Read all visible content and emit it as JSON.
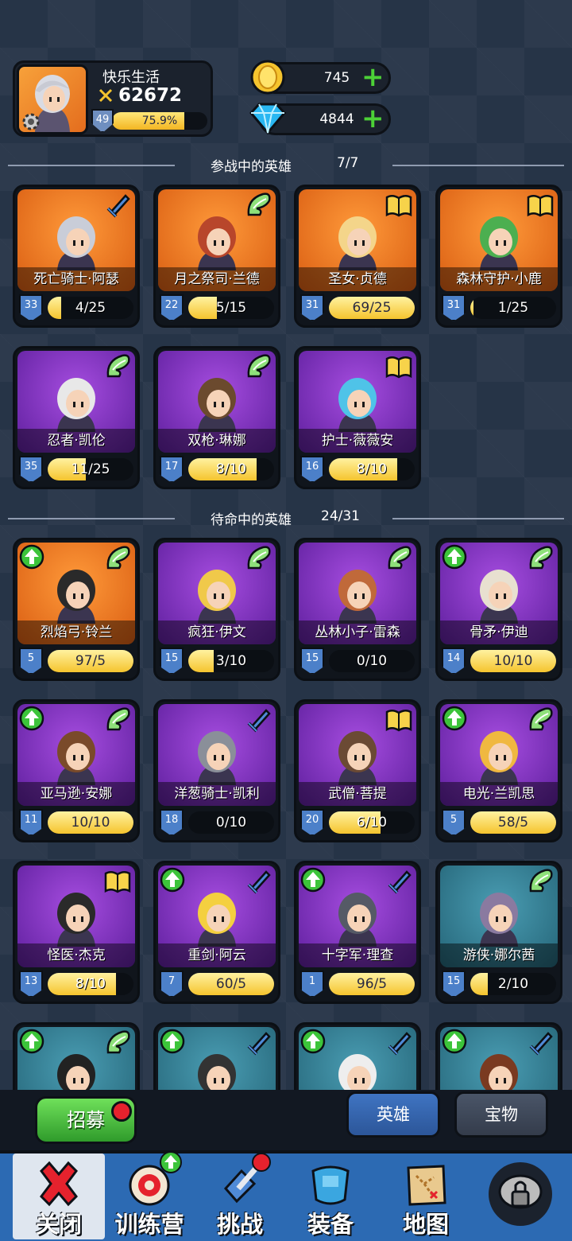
{
  "profile": {
    "name": "快乐生活",
    "power": "62672",
    "level": "49",
    "xp_percent": "75.9%",
    "xp_fraction": 0.759
  },
  "currency": {
    "gold": "745",
    "gems": "4844"
  },
  "active": {
    "title": "参战中的英雄",
    "count": "7/7"
  },
  "reserve": {
    "title": "待命中的英雄",
    "count": "24/31"
  },
  "cards": [
    {
      "name": "死亡骑士·阿瑟",
      "level": "33",
      "progress": "4/25",
      "fill": 0.16,
      "bg": "orange",
      "badge": "sword-icon",
      "up": false
    },
    {
      "name": "月之祭司·兰德",
      "level": "22",
      "progress": "5/15",
      "fill": 0.33,
      "bg": "orange",
      "badge": "wing-icon",
      "up": false
    },
    {
      "name": "圣女·贞德",
      "level": "31",
      "progress": "69/25",
      "fill": 1,
      "bg": "orange",
      "badge": "book-icon",
      "up": false
    },
    {
      "name": "森林守护·小鹿",
      "level": "31",
      "progress": "1/25",
      "fill": 0.04,
      "bg": "orange",
      "badge": "book-icon",
      "up": false
    },
    {
      "name": "忍者·凯伦",
      "level": "35",
      "progress": "11/25",
      "fill": 0.44,
      "bg": "purple",
      "badge": "wing-icon",
      "up": false
    },
    {
      "name": "双枪·琳娜",
      "level": "17",
      "progress": "8/10",
      "fill": 0.8,
      "bg": "purple",
      "badge": "wing-icon",
      "up": false
    },
    {
      "name": "护士·薇薇安",
      "level": "16",
      "progress": "8/10",
      "fill": 0.8,
      "bg": "purple",
      "badge": "book-icon",
      "up": false
    },
    {
      "name": "烈焰弓·铃兰",
      "level": "5",
      "progress": "97/5",
      "fill": 1,
      "bg": "orange",
      "badge": "wing-icon",
      "up": true
    },
    {
      "name": "疯狂·伊文",
      "level": "15",
      "progress": "3/10",
      "fill": 0.3,
      "bg": "purple",
      "badge": "wing-icon",
      "up": false
    },
    {
      "name": "丛林小子·雷森",
      "level": "15",
      "progress": "0/10",
      "fill": 0,
      "bg": "purple",
      "badge": "wing-icon",
      "up": false
    },
    {
      "name": "骨矛·伊迪",
      "level": "14",
      "progress": "10/10",
      "fill": 1,
      "bg": "purple",
      "badge": "wing-icon",
      "up": true
    },
    {
      "name": "亚马逊·安娜",
      "level": "11",
      "progress": "10/10",
      "fill": 1,
      "bg": "purple",
      "badge": "wing-icon",
      "up": true
    },
    {
      "name": "洋葱骑士·凯利",
      "level": "18",
      "progress": "0/10",
      "fill": 0,
      "bg": "purple",
      "badge": "sword-icon",
      "up": false
    },
    {
      "name": "武僧·菩提",
      "level": "20",
      "progress": "6/10",
      "fill": 0.6,
      "bg": "purple",
      "badge": "book-icon",
      "up": false
    },
    {
      "name": "电光·兰凯思",
      "level": "5",
      "progress": "58/5",
      "fill": 1,
      "bg": "purple",
      "badge": "wing-icon",
      "up": true
    },
    {
      "name": "怪医·杰克",
      "level": "13",
      "progress": "8/10",
      "fill": 0.8,
      "bg": "purple",
      "badge": "book-icon",
      "up": false
    },
    {
      "name": "重剑·阿云",
      "level": "7",
      "progress": "60/5",
      "fill": 1,
      "bg": "purple",
      "badge": "sword-icon",
      "up": true
    },
    {
      "name": "十字军·理查",
      "level": "1",
      "progress": "96/5",
      "fill": 1,
      "bg": "purple",
      "badge": "sword-icon",
      "up": true
    },
    {
      "name": "游侠·娜尔茜",
      "level": "15",
      "progress": "2/10",
      "fill": 0.2,
      "bg": "teal",
      "badge": "wing-icon",
      "up": false
    },
    {
      "name": "",
      "level": "",
      "progress": "",
      "fill": 0,
      "bg": "teal",
      "badge": "wing-icon",
      "up": true
    },
    {
      "name": "",
      "level": "",
      "progress": "",
      "fill": 0,
      "bg": "teal",
      "badge": "sword-icon",
      "up": true
    },
    {
      "name": "",
      "level": "",
      "progress": "",
      "fill": 0,
      "bg": "teal",
      "badge": "sword-icon",
      "up": true
    },
    {
      "name": "",
      "level": "",
      "progress": "",
      "fill": 0,
      "bg": "teal",
      "badge": "sword-icon",
      "up": true
    }
  ],
  "actions": {
    "recruit": "招募",
    "tab_heroes": "英雄",
    "tab_treasure": "宝物"
  },
  "nav": [
    {
      "label": "关闭",
      "icon": "close-icon"
    },
    {
      "label": "训练营",
      "icon": "target-icon"
    },
    {
      "label": "挑战",
      "icon": "battle-sword-icon"
    },
    {
      "label": "装备",
      "icon": "armor-icon"
    },
    {
      "label": "地图",
      "icon": "map-icon"
    },
    {
      "label": "",
      "icon": "lock-icon"
    }
  ],
  "colors": {
    "gold": "#f5c42e",
    "xp": "#f3b622",
    "green": "#4cd137",
    "red_dot": "#e5222d",
    "nav": "#2c6ab3"
  }
}
